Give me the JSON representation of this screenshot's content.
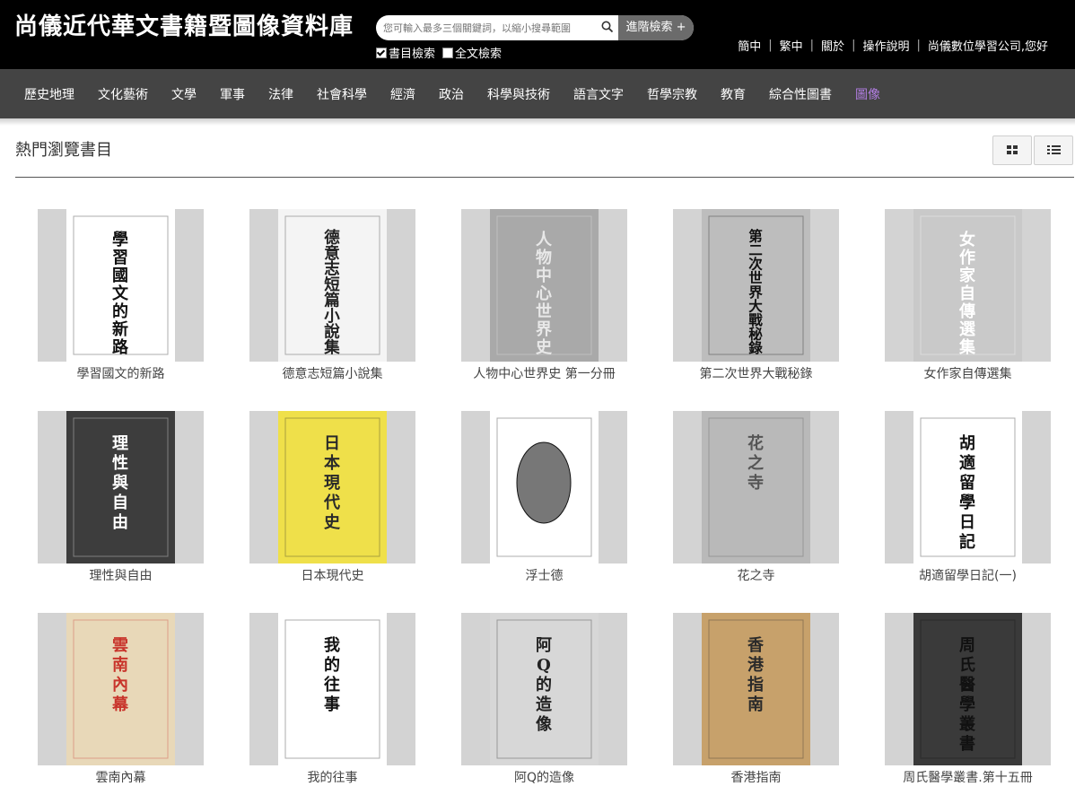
{
  "header": {
    "logo": "尚儀近代華文書籍暨圖像資料庫",
    "search_placeholder": "您可輸入最多三個關鍵詞，以縮小搜尋範圍",
    "advanced_label": "進階檢索 +",
    "opt_catalog": "書目檢索",
    "opt_fulltext": "全文檢索",
    "links": [
      "簡中",
      "繁中",
      "關於",
      "操作說明",
      "尚儀數位學習公司,您好"
    ]
  },
  "nav": [
    "歷史地理",
    "文化藝術",
    "文學",
    "軍事",
    "法律",
    "社會科學",
    "經濟",
    "政治",
    "科學與技術",
    "語言文字",
    "哲學宗教",
    "教育",
    "綜合性圖書",
    "圖像"
  ],
  "nav_active_color": "#b07de0",
  "main": {
    "section_title": "熱門瀏覽書目",
    "view_grid_icon": "grid-icon",
    "view_list_icon": "list-icon"
  },
  "books": [
    {
      "title": "學習國文的新路",
      "cover_text": "學習國文的新路",
      "bg": "#ffffff",
      "fg": "#111111"
    },
    {
      "title": "德意志短篇小說集",
      "cover_text": "德意志短篇小說集",
      "bg": "#f4f4f4",
      "fg": "#222222"
    },
    {
      "title": "人物中心世界史 第一分冊",
      "cover_text": "人物中心世界史",
      "bg": "#a9a9a9",
      "fg": "#e8e8e8"
    },
    {
      "title": "第二次世界大戰秘錄",
      "cover_text": "第二次世界大戰秘錄",
      "bg": "#bdbdbd",
      "fg": "#111111"
    },
    {
      "title": "女作家自傳選集",
      "cover_text": "女作家自傳選集",
      "bg": "#c9c9c9",
      "fg": "#ffffff"
    },
    {
      "title": "理性與自由",
      "cover_text": "理性與自由",
      "bg": "#3d3d3d",
      "fg": "#ffffff"
    },
    {
      "title": "日本現代史",
      "cover_text": "日本現代史",
      "bg": "#efe04a",
      "fg": "#2a2a2a"
    },
    {
      "title": "浮士德",
      "cover_text": "",
      "bg": "#ffffff",
      "fg": "#111111"
    },
    {
      "title": "花之寺",
      "cover_text": "花之寺",
      "bg": "#b9b9b9",
      "fg": "#555555"
    },
    {
      "title": "胡適留學日記(一)",
      "cover_text": "胡適留學日記",
      "bg": "#ffffff",
      "fg": "#111111"
    },
    {
      "title": "雲南內幕",
      "cover_text": "雲南內幕",
      "bg": "#e8d8b8",
      "fg": "#c8342b"
    },
    {
      "title": "我的往事",
      "cover_text": "我的往事",
      "bg": "#ffffff",
      "fg": "#111111"
    },
    {
      "title": "阿Q的造像",
      "cover_text": "阿Q的造像",
      "bg": "#d7d7d7",
      "fg": "#222222"
    },
    {
      "title": "香港指南",
      "cover_text": "香港指南",
      "bg": "#c7a16b",
      "fg": "#2a2a2a"
    },
    {
      "title": "周氏醫學叢書.第十五冊",
      "cover_text": "周氏醫學叢書",
      "bg": "#3a3a3a",
      "fg": "#111111"
    }
  ]
}
